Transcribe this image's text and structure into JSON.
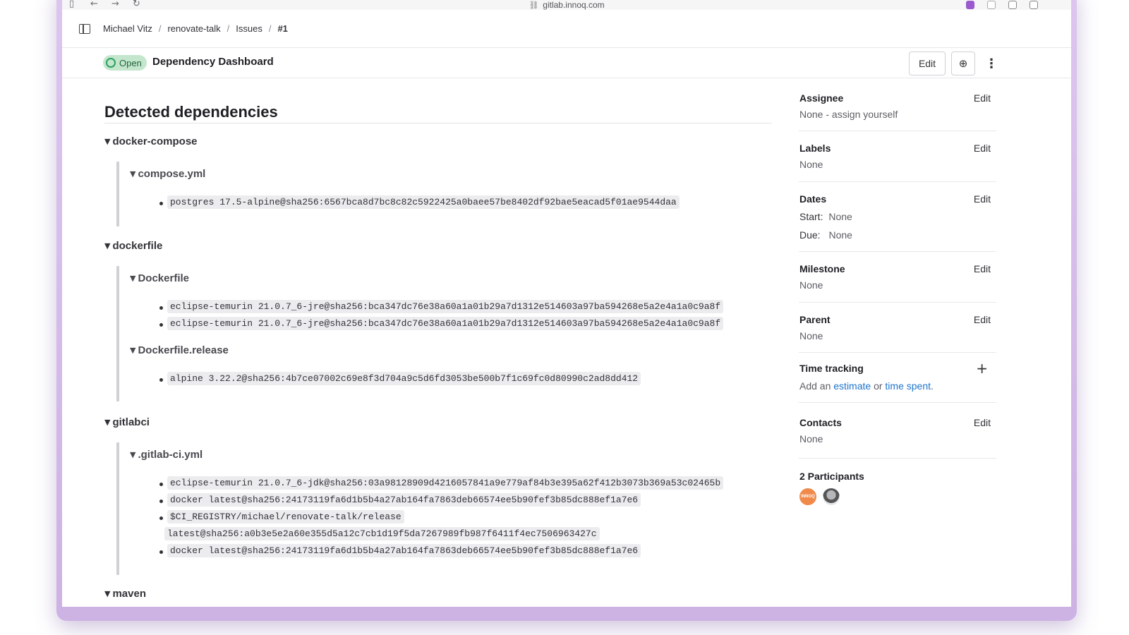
{
  "browser": {
    "url": "gitlab.innoq.com"
  },
  "breadcrumb": {
    "items": [
      "Michael Vitz",
      "renovate-talk",
      "Issues"
    ],
    "current": "#1",
    "separator": "/"
  },
  "issue": {
    "status": "Open",
    "title": "Dependency Dashboard",
    "edit_label": "Edit",
    "colors": {
      "status_bg": "#c3e6cd",
      "status_fg": "#24663b"
    }
  },
  "main": {
    "section_title": "Detected dependencies",
    "groups": [
      {
        "name": "docker-compose",
        "files": [
          {
            "name": "compose.yml",
            "deps": [
              "postgres 17.5-alpine@sha256:6567bca8d7bc8c82c5922425a0baee57be8402df92bae5eacad5f01ae9544daa"
            ]
          }
        ]
      },
      {
        "name": "dockerfile",
        "files": [
          {
            "name": "Dockerfile",
            "deps": [
              "eclipse-temurin 21.0.7_6-jre@sha256:bca347dc76e38a60a1a01b29a7d1312e514603a97ba594268e5a2e4a1a0c9a8f",
              "eclipse-temurin 21.0.7_6-jre@sha256:bca347dc76e38a60a1a01b29a7d1312e514603a97ba594268e5a2e4a1a0c9a8f"
            ]
          },
          {
            "name": "Dockerfile.release",
            "deps": [
              "alpine 3.22.2@sha256:4b7ce07002c69e8f3d704a9c5d6fd3053be500b7f1c69fc0d80990c2ad8dd412"
            ]
          }
        ]
      },
      {
        "name": "gitlabci",
        "files": [
          {
            "name": ".gitlab-ci.yml",
            "deps": [
              "eclipse-temurin 21.0.7_6-jdk@sha256:03a98128909d4216057841a9e779af84b3e395a62f412b3073b369a53c02465b",
              "docker latest@sha256:24173119fa6d1b5b4a27ab164fa7863deb66574ee5b90fef3b85dc888ef1a7e6",
              "$CI_REGISTRY/michael/renovate-talk/release",
              "latest@sha256:a0b3e5e2a60e355d5a12c7cb1d19f5da7267989fb987f6411f4ec7506963427c",
              "docker latest@sha256:24173119fa6d1b5b4a27ab164fa7863deb66574ee5b90fef3b85dc888ef1a7e6"
            ]
          }
        ]
      },
      {
        "name": "maven"
      }
    ]
  },
  "sidebar": {
    "edit_label": "Edit",
    "assignee": {
      "title": "Assignee",
      "value": "None - assign yourself"
    },
    "labels": {
      "title": "Labels",
      "value": "None"
    },
    "dates": {
      "title": "Dates",
      "start_label": "Start:",
      "start": "None",
      "due_label": "Due:",
      "due": "None"
    },
    "milestone": {
      "title": "Milestone",
      "value": "None"
    },
    "parent": {
      "title": "Parent",
      "value": "None"
    },
    "time_tracking": {
      "title": "Time tracking",
      "prefix": "Add an",
      "estimate": "estimate",
      "or": "or",
      "spent": "time spent",
      "suffix": ".",
      "add_icon": "plus-icon"
    },
    "contacts": {
      "title": "Contacts",
      "value": "None"
    },
    "participants": {
      "title": "2 Participants",
      "avatars": [
        "innoq-avatar",
        "user-avatar"
      ]
    }
  }
}
